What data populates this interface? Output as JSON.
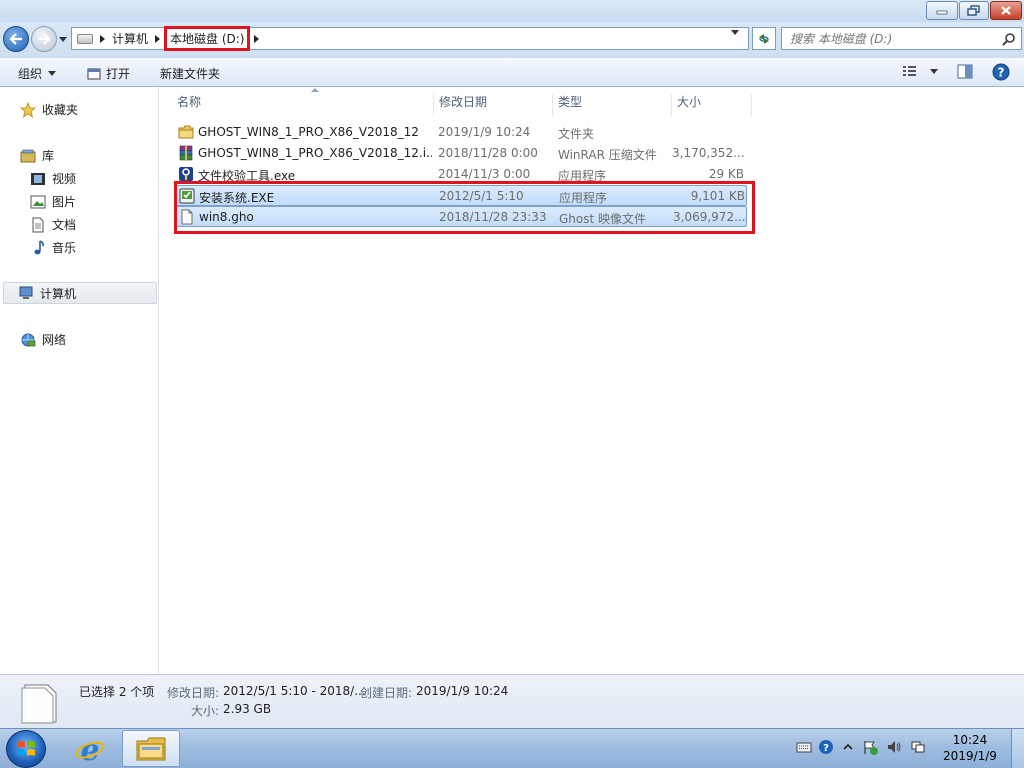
{
  "window": {
    "title_buttons": [
      "minimize",
      "maximize",
      "close"
    ]
  },
  "address_bar": {
    "breadcrumbs": [
      "计算机",
      "本地磁盘 (D:)"
    ],
    "search_placeholder": "搜索 本地磁盘 (D:)"
  },
  "toolbar": {
    "organize": "组织",
    "open": "打开",
    "new_folder": "新建文件夹"
  },
  "nav": {
    "favorites": "收藏夹",
    "libraries": "库",
    "videos": "视频",
    "pictures": "图片",
    "documents": "文档",
    "music": "音乐",
    "computer": "计算机",
    "network": "网络"
  },
  "columns": {
    "name": "名称",
    "date": "修改日期",
    "type": "类型",
    "size": "大小"
  },
  "files": [
    {
      "name": "GHOST_WIN8_1_PRO_X86_V2018_12",
      "date": "2019/1/9 10:24",
      "type": "文件夹",
      "size": "",
      "icon": "folder-icon",
      "selected": false
    },
    {
      "name": "GHOST_WIN8_1_PRO_X86_V2018_12.i...",
      "date": "2018/11/28 0:00",
      "type": "WinRAR 压缩文件",
      "size": "3,170,352...",
      "icon": "winrar-archive-icon",
      "selected": false
    },
    {
      "name": "文件校验工具.exe",
      "date": "2014/11/3 0:00",
      "type": "应用程序",
      "size": "29 KB",
      "icon": "checksum-tool-icon",
      "selected": false
    },
    {
      "name": "安装系统.EXE",
      "date": "2012/5/1 5:10",
      "type": "应用程序",
      "size": "9,101 KB",
      "icon": "installer-icon",
      "selected": true
    },
    {
      "name": "win8.gho",
      "date": "2018/11/28 23:33",
      "type": "Ghost 映像文件",
      "size": "3,069,972...",
      "icon": "file-icon",
      "selected": true
    }
  ],
  "details": {
    "selection": "已选择 2 个项",
    "modified_label": "修改日期:",
    "modified_value": "2012/5/1 5:10 - 2018/...",
    "created_label": "创建日期:",
    "created_value": "2019/1/9 10:24",
    "size_label": "大小:",
    "size_value": "2.93 GB"
  },
  "taskbar": {
    "time": "10:24",
    "date": "2019/1/9"
  },
  "colors": {
    "highlight_red": "#e0141e",
    "selection_blue": "#c1dcfc"
  }
}
